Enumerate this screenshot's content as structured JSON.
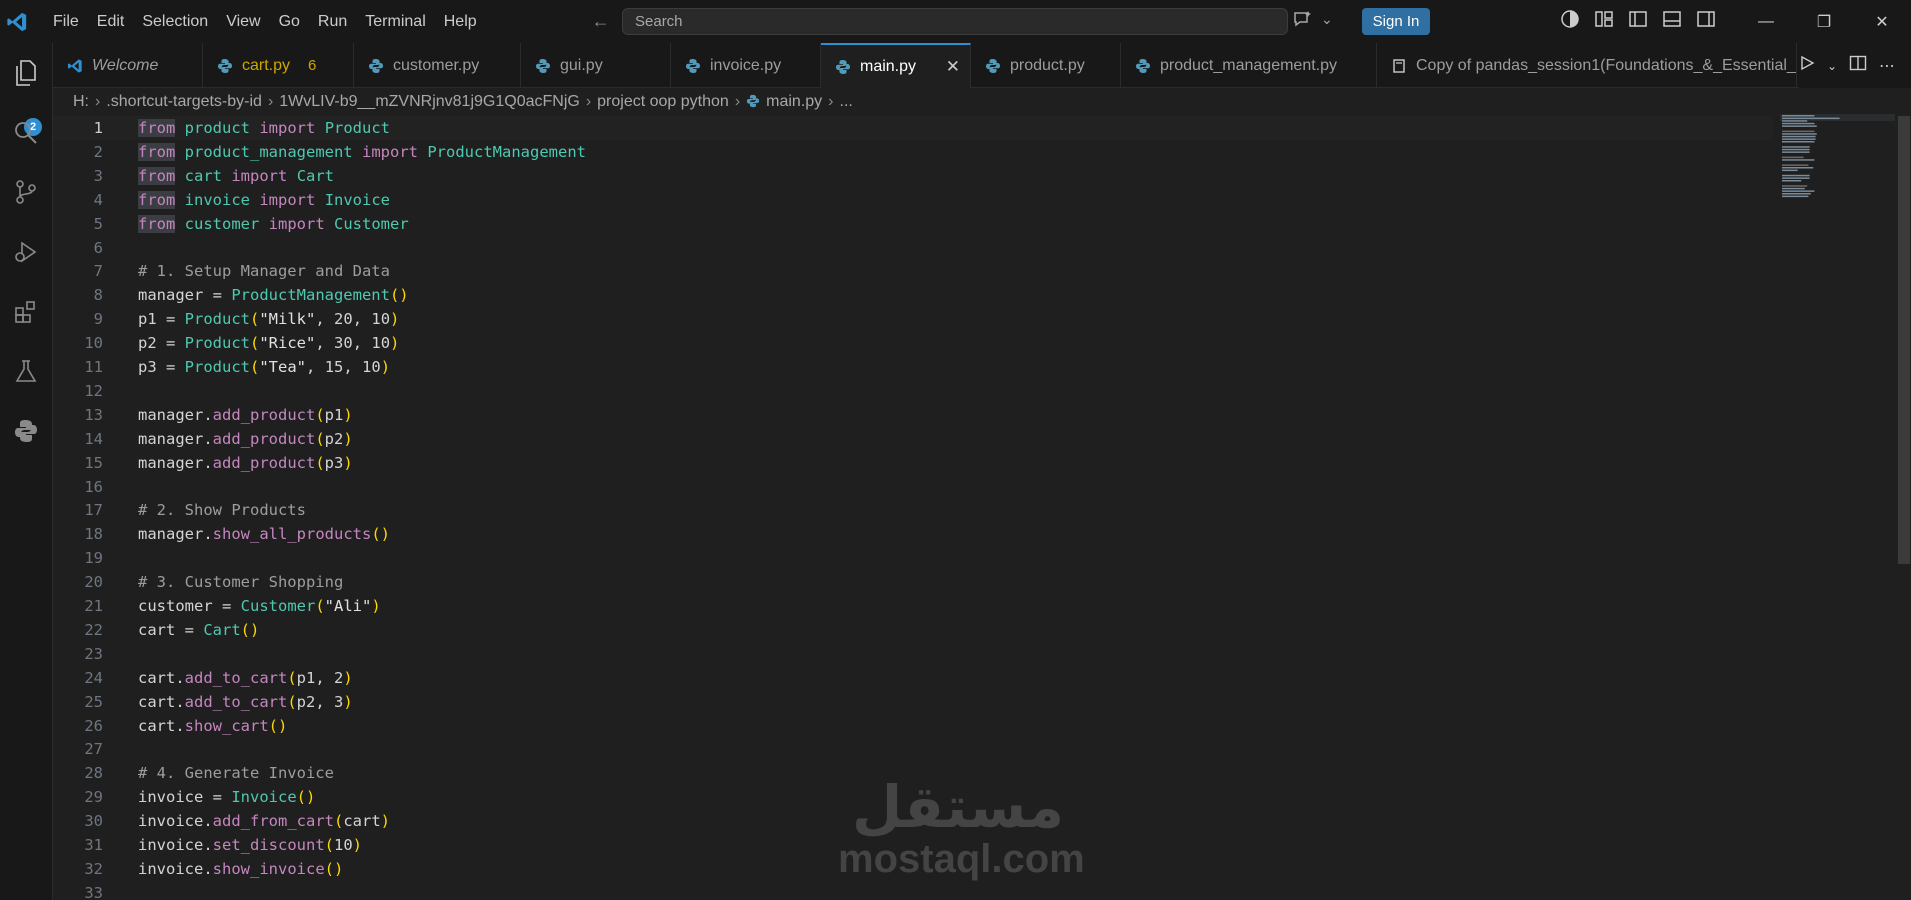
{
  "menu": [
    "File",
    "Edit",
    "Selection",
    "View",
    "Go",
    "Run",
    "Terminal",
    "Help"
  ],
  "search": {
    "placeholder": "Search"
  },
  "signin_label": "Sign In",
  "badge": "2",
  "tabs": [
    {
      "label": "Welcome",
      "icon": "vscode-icon",
      "italic": true
    },
    {
      "label": "cart.py",
      "icon": "python-icon",
      "modified": true,
      "count": "6"
    },
    {
      "label": "customer.py",
      "icon": "python-icon"
    },
    {
      "label": "gui.py",
      "icon": "python-icon"
    },
    {
      "label": "invoice.py",
      "icon": "python-icon"
    },
    {
      "label": "main.py",
      "icon": "python-icon",
      "active": true
    },
    {
      "label": "product.py",
      "icon": "python-icon"
    },
    {
      "label": "product_management.py",
      "icon": "python-icon"
    },
    {
      "label": "Copy of pandas_session1(Foundations_&_Essential_",
      "icon": "notebook-icon"
    }
  ],
  "breadcrumb": [
    "H:",
    ".shortcut-targets-by-id",
    "1WvLIV-b9__mZVNRjnv81j9G1Q0acFNjG",
    "project oop python",
    "main.py",
    "..."
  ],
  "code": [
    [
      [
        "from",
        "kw",
        "fromhl"
      ],
      [
        " ",
        ""
      ],
      [
        "product",
        "mod"
      ],
      [
        " ",
        ""
      ],
      [
        "import",
        "kw"
      ],
      [
        " ",
        ""
      ],
      [
        "Product",
        "cls"
      ]
    ],
    [
      [
        "from",
        "kw",
        "fromhl"
      ],
      [
        " ",
        ""
      ],
      [
        "product_management",
        "mod"
      ],
      [
        " ",
        ""
      ],
      [
        "import",
        "kw"
      ],
      [
        " ",
        ""
      ],
      [
        "ProductManagement",
        "cls"
      ]
    ],
    [
      [
        "from",
        "kw",
        "fromhl"
      ],
      [
        " ",
        ""
      ],
      [
        "cart",
        "mod"
      ],
      [
        " ",
        ""
      ],
      [
        "import",
        "kw"
      ],
      [
        " ",
        ""
      ],
      [
        "Cart",
        "cls"
      ]
    ],
    [
      [
        "from",
        "kw",
        "fromhl"
      ],
      [
        " ",
        ""
      ],
      [
        "invoice",
        "mod"
      ],
      [
        " ",
        ""
      ],
      [
        "import",
        "kw"
      ],
      [
        " ",
        ""
      ],
      [
        "Invoice",
        "cls"
      ]
    ],
    [
      [
        "from",
        "kw",
        "fromhl"
      ],
      [
        " ",
        ""
      ],
      [
        "customer",
        "mod"
      ],
      [
        " ",
        ""
      ],
      [
        "import",
        "kw"
      ],
      [
        " ",
        ""
      ],
      [
        "Customer",
        "cls"
      ]
    ],
    [],
    [
      [
        "# 1. Setup Manager and Data",
        "com"
      ]
    ],
    [
      [
        "manager",
        "var"
      ],
      [
        " = ",
        "op"
      ],
      [
        "ProductManagement",
        "cls"
      ],
      [
        "()",
        "par"
      ]
    ],
    [
      [
        "p1",
        "var"
      ],
      [
        " = ",
        "op"
      ],
      [
        "Product",
        "cls"
      ],
      [
        "(",
        "par"
      ],
      [
        "\"Milk\"",
        "strW"
      ],
      [
        ", ",
        "op"
      ],
      [
        "20",
        "var"
      ],
      [
        ", ",
        "op"
      ],
      [
        "10",
        "var"
      ],
      [
        ")",
        "par"
      ]
    ],
    [
      [
        "p2",
        "var"
      ],
      [
        " = ",
        "op"
      ],
      [
        "Product",
        "cls"
      ],
      [
        "(",
        "par"
      ],
      [
        "\"Rice\"",
        "strW"
      ],
      [
        ", ",
        "op"
      ],
      [
        "30",
        "var"
      ],
      [
        ", ",
        "op"
      ],
      [
        "10",
        "var"
      ],
      [
        ")",
        "par"
      ]
    ],
    [
      [
        "p3",
        "var"
      ],
      [
        " = ",
        "op"
      ],
      [
        "Product",
        "cls"
      ],
      [
        "(",
        "par"
      ],
      [
        "\"Tea\"",
        "strW"
      ],
      [
        ", ",
        "op"
      ],
      [
        "15",
        "var"
      ],
      [
        ", ",
        "op"
      ],
      [
        "10",
        "var"
      ],
      [
        ")",
        "par"
      ]
    ],
    [],
    [
      [
        "manager",
        "var"
      ],
      [
        ".",
        "op"
      ],
      [
        "add_product",
        "fnV"
      ],
      [
        "(",
        "par"
      ],
      [
        "p1",
        "var"
      ],
      [
        ")",
        "par"
      ]
    ],
    [
      [
        "manager",
        "var"
      ],
      [
        ".",
        "op"
      ],
      [
        "add_product",
        "fnV"
      ],
      [
        "(",
        "par"
      ],
      [
        "p2",
        "var"
      ],
      [
        ")",
        "par"
      ]
    ],
    [
      [
        "manager",
        "var"
      ],
      [
        ".",
        "op"
      ],
      [
        "add_product",
        "fnV"
      ],
      [
        "(",
        "par"
      ],
      [
        "p3",
        "var"
      ],
      [
        ")",
        "par"
      ]
    ],
    [],
    [
      [
        "# 2. Show Products",
        "com"
      ]
    ],
    [
      [
        "manager",
        "var"
      ],
      [
        ".",
        "op"
      ],
      [
        "show_all_products",
        "fnV"
      ],
      [
        "()",
        "par"
      ]
    ],
    [],
    [
      [
        "# 3. Customer Shopping",
        "com"
      ]
    ],
    [
      [
        "customer",
        "var"
      ],
      [
        " = ",
        "op"
      ],
      [
        "Customer",
        "cls"
      ],
      [
        "(",
        "par"
      ],
      [
        "\"Ali\"",
        "strW"
      ],
      [
        ")",
        "par"
      ]
    ],
    [
      [
        "cart",
        "var"
      ],
      [
        " = ",
        "op"
      ],
      [
        "Cart",
        "cls"
      ],
      [
        "()",
        "par"
      ]
    ],
    [],
    [
      [
        "cart",
        "var"
      ],
      [
        ".",
        "op"
      ],
      [
        "add_to_cart",
        "fnV"
      ],
      [
        "(",
        "par"
      ],
      [
        "p1",
        "var"
      ],
      [
        ", ",
        "op"
      ],
      [
        "2",
        "var"
      ],
      [
        ")",
        "par"
      ]
    ],
    [
      [
        "cart",
        "var"
      ],
      [
        ".",
        "op"
      ],
      [
        "add_to_cart",
        "fnV"
      ],
      [
        "(",
        "par"
      ],
      [
        "p2",
        "var"
      ],
      [
        ", ",
        "op"
      ],
      [
        "3",
        "var"
      ],
      [
        ")",
        "par"
      ]
    ],
    [
      [
        "cart",
        "var"
      ],
      [
        ".",
        "op"
      ],
      [
        "show_cart",
        "fnV"
      ],
      [
        "()",
        "par"
      ]
    ],
    [],
    [
      [
        "# 4. Generate Invoice",
        "com"
      ]
    ],
    [
      [
        "invoice",
        "var"
      ],
      [
        " = ",
        "op"
      ],
      [
        "Invoice",
        "cls"
      ],
      [
        "()",
        "par"
      ]
    ],
    [
      [
        "invoice",
        "var"
      ],
      [
        ".",
        "op"
      ],
      [
        "add_from_cart",
        "fnV"
      ],
      [
        "(",
        "par"
      ],
      [
        "cart",
        "var"
      ],
      [
        ")",
        "par"
      ]
    ],
    [
      [
        "invoice",
        "var"
      ],
      [
        ".",
        "op"
      ],
      [
        "set_discount",
        "fnV"
      ],
      [
        "(",
        "par"
      ],
      [
        "10",
        "var"
      ],
      [
        ")",
        "par"
      ]
    ],
    [
      [
        "invoice",
        "var"
      ],
      [
        ".",
        "op"
      ],
      [
        "show_invoice",
        "fnV"
      ],
      [
        "()",
        "par"
      ]
    ],
    []
  ],
  "watermark": {
    "arabic": "مستقل",
    "latin": "mostaql.com"
  },
  "colors": {
    "accent": "#2f8fd1",
    "signin": "#2f6fa1",
    "modified": "#cca700"
  }
}
